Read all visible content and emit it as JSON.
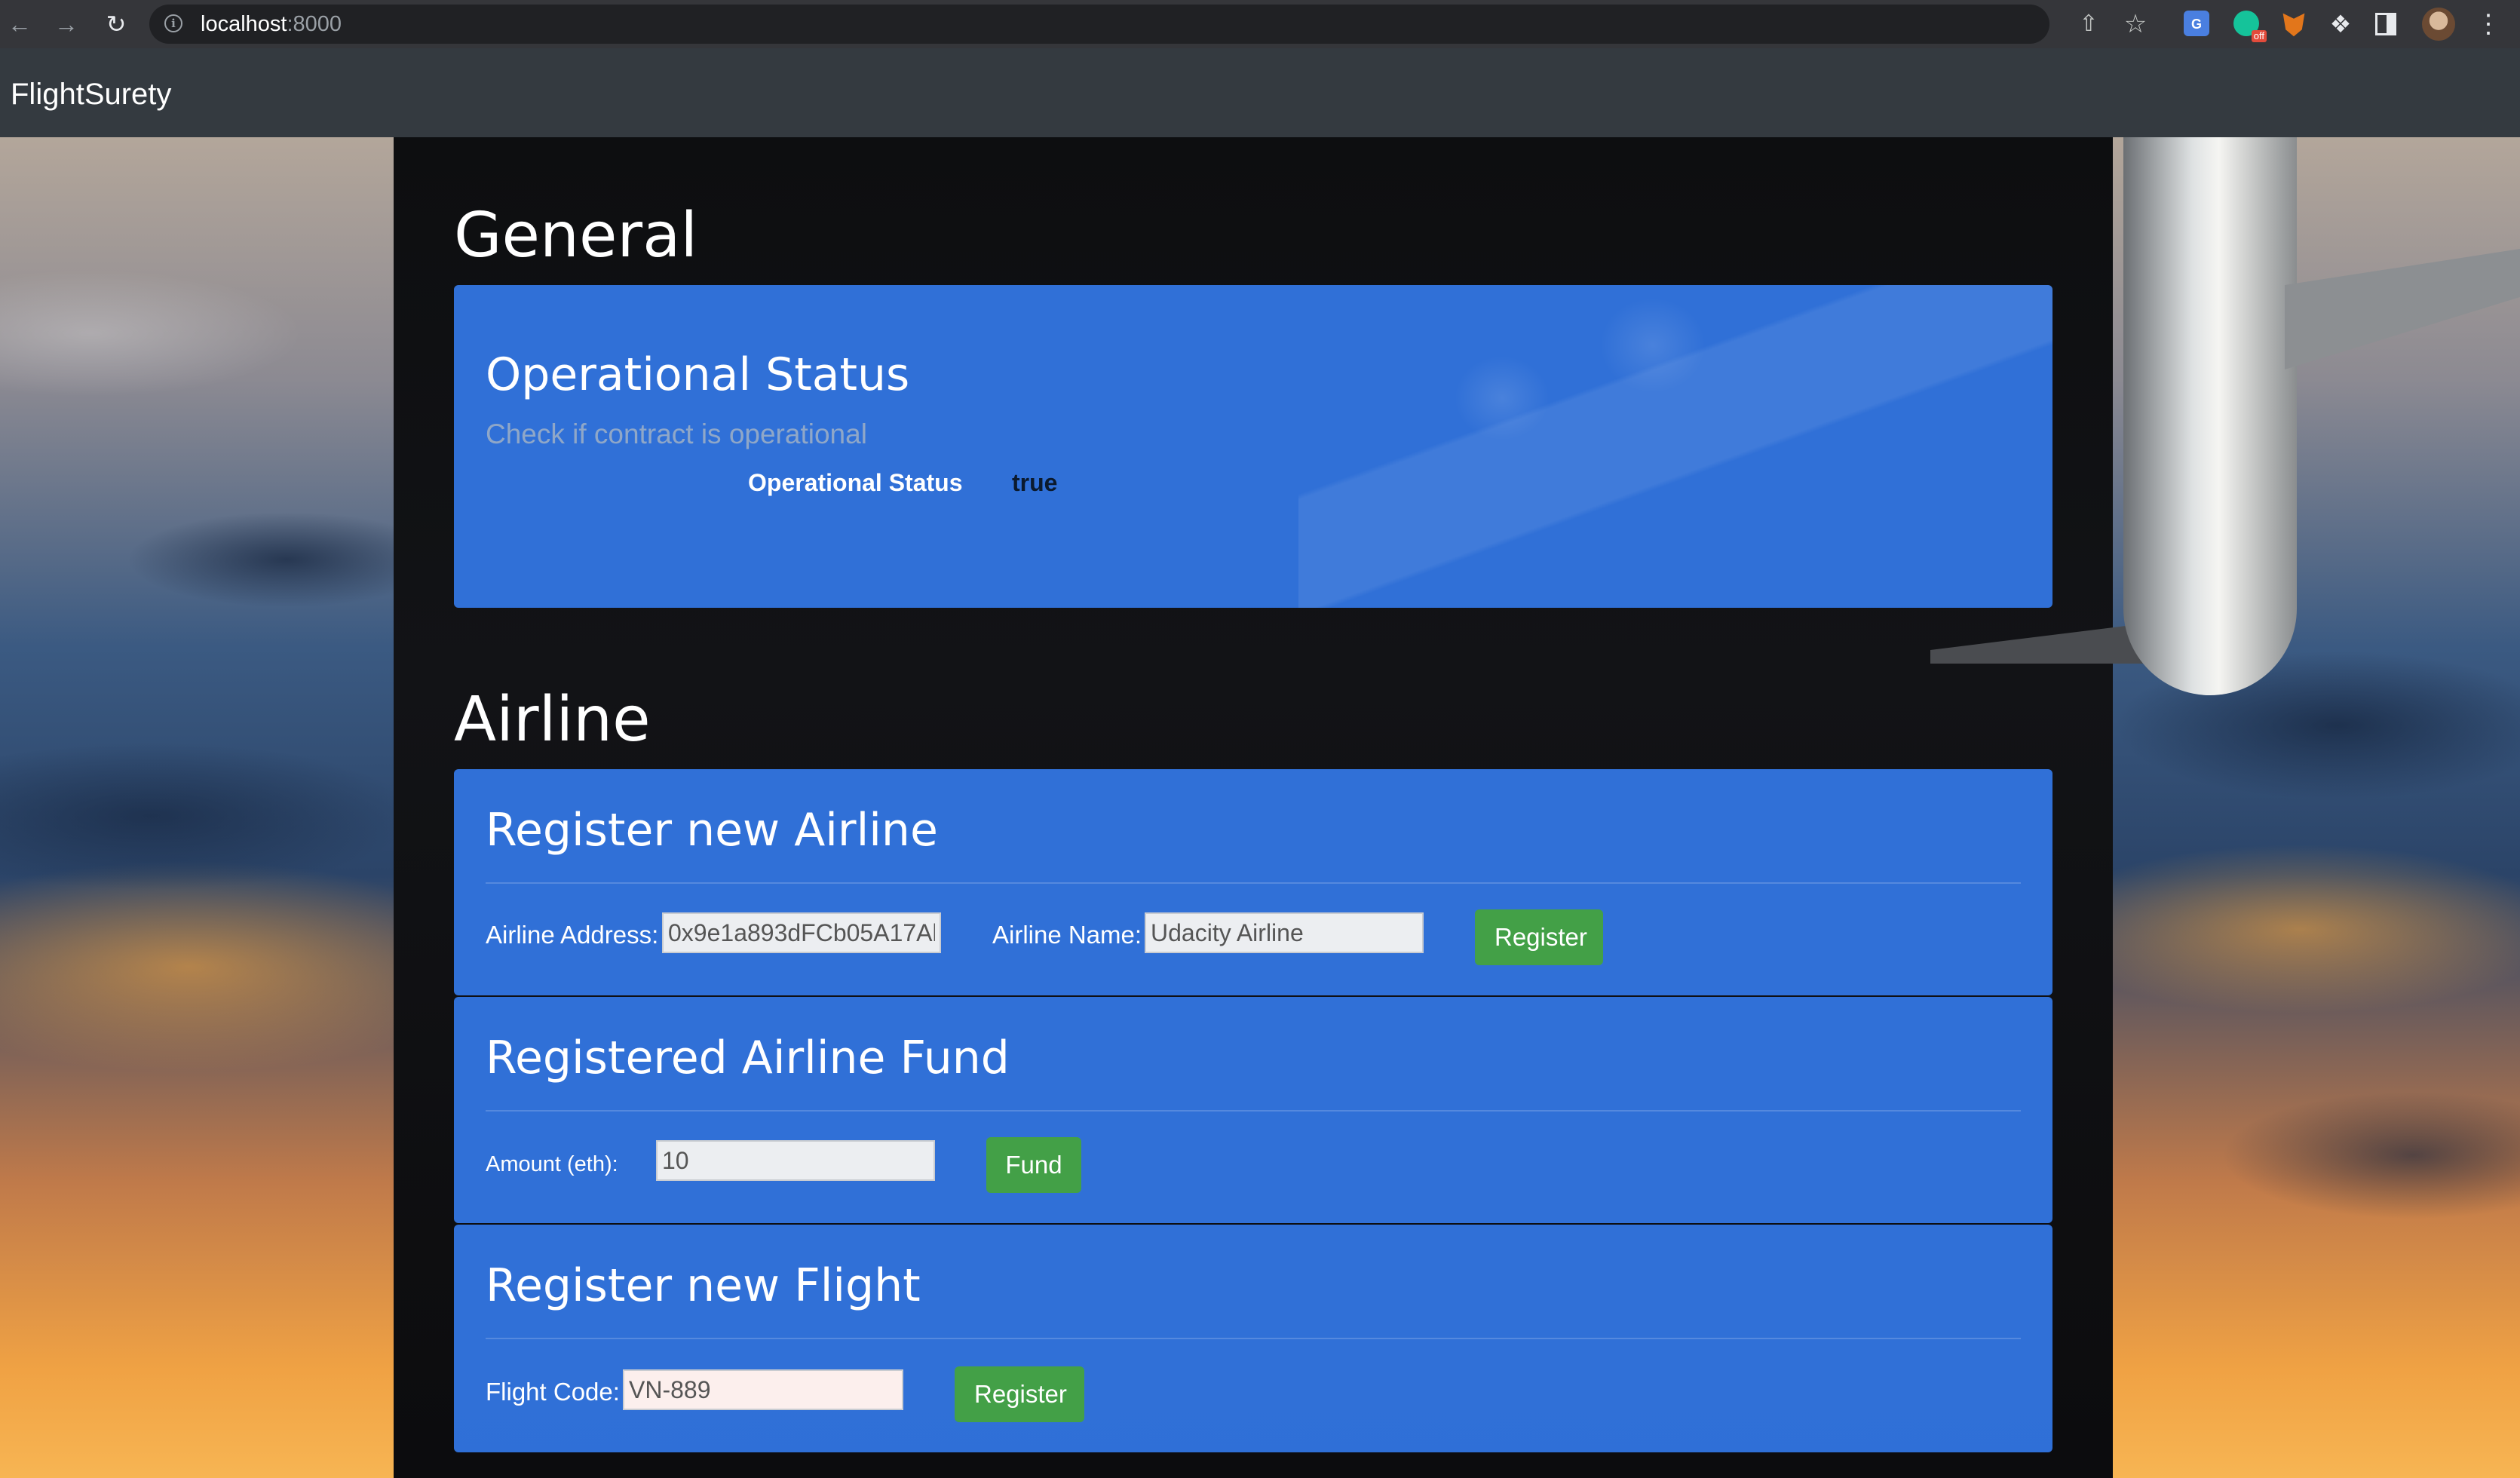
{
  "browser": {
    "url_host": "localhost",
    "url_port": ":8000",
    "info_glyph": "i",
    "extension_badge": "off",
    "translate_glyph": "G"
  },
  "navbar": {
    "brand": "FlightSurety"
  },
  "general": {
    "section_title": "General",
    "card_title": "Operational Status",
    "card_subtitle": "Check if contract is operational",
    "status_label": "Operational Status",
    "status_value": "true"
  },
  "airline": {
    "section_title": "Airline",
    "register_airline": {
      "title": "Register new Airline",
      "address_label": "Airline Address:",
      "address_value": "0x9e1a893dFCb05A17Al",
      "name_label": "Airline Name:",
      "name_value": "Udacity Airline",
      "button_label": "Register"
    },
    "fund": {
      "title": "Registered Airline Fund",
      "amount_label": "Amount (eth):",
      "amount_value": "10",
      "button_label": "Fund"
    },
    "register_flight": {
      "title": "Register new Flight",
      "code_label": "Flight Code:",
      "code_value": "VN-889",
      "button_label": "Register"
    }
  },
  "icons": {
    "back": "arrow-left-icon",
    "forward": "arrow-right-icon",
    "reload": "reload-icon",
    "share": "share-icon",
    "bookmark": "star-icon",
    "extensions": "puzzle-icon",
    "menu": "kebab-menu-icon"
  },
  "colors": {
    "card": "#3378e8",
    "button": "#43a047",
    "navbar": "#343a40"
  }
}
